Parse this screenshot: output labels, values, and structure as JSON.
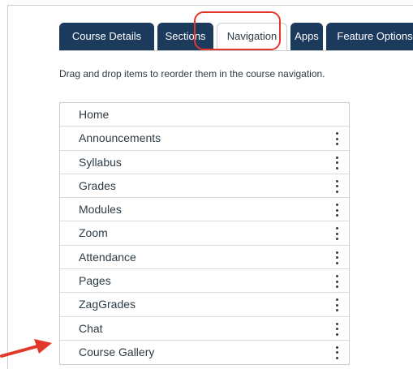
{
  "tabs": [
    {
      "label": "Course Details",
      "active": false
    },
    {
      "label": "Sections",
      "active": false
    },
    {
      "label": "Navigation",
      "active": true
    },
    {
      "label": "Apps",
      "active": false
    },
    {
      "label": "Feature Options",
      "active": false
    }
  ],
  "instructions": "Drag and drop items to reorder them in the course navigation.",
  "nav_items": [
    {
      "label": "Home",
      "menu_icon": false
    },
    {
      "label": "Announcements",
      "menu_icon": true
    },
    {
      "label": "Syllabus",
      "menu_icon": true
    },
    {
      "label": "Grades",
      "menu_icon": true
    },
    {
      "label": "Modules",
      "menu_icon": true
    },
    {
      "label": "Zoom",
      "menu_icon": true
    },
    {
      "label": "Attendance",
      "menu_icon": true
    },
    {
      "label": "Pages",
      "menu_icon": true
    },
    {
      "label": "ZagGrades",
      "menu_icon": true
    },
    {
      "label": "Chat",
      "menu_icon": true
    },
    {
      "label": "Course Gallery",
      "menu_icon": true
    }
  ],
  "colors": {
    "tab_background": "#1c3a5c",
    "highlight": "#e2372b",
    "text": "#2d3b45"
  },
  "icons": {
    "item_menu": "kebab-menu-icon",
    "annotation": "red-arrow-icon"
  }
}
